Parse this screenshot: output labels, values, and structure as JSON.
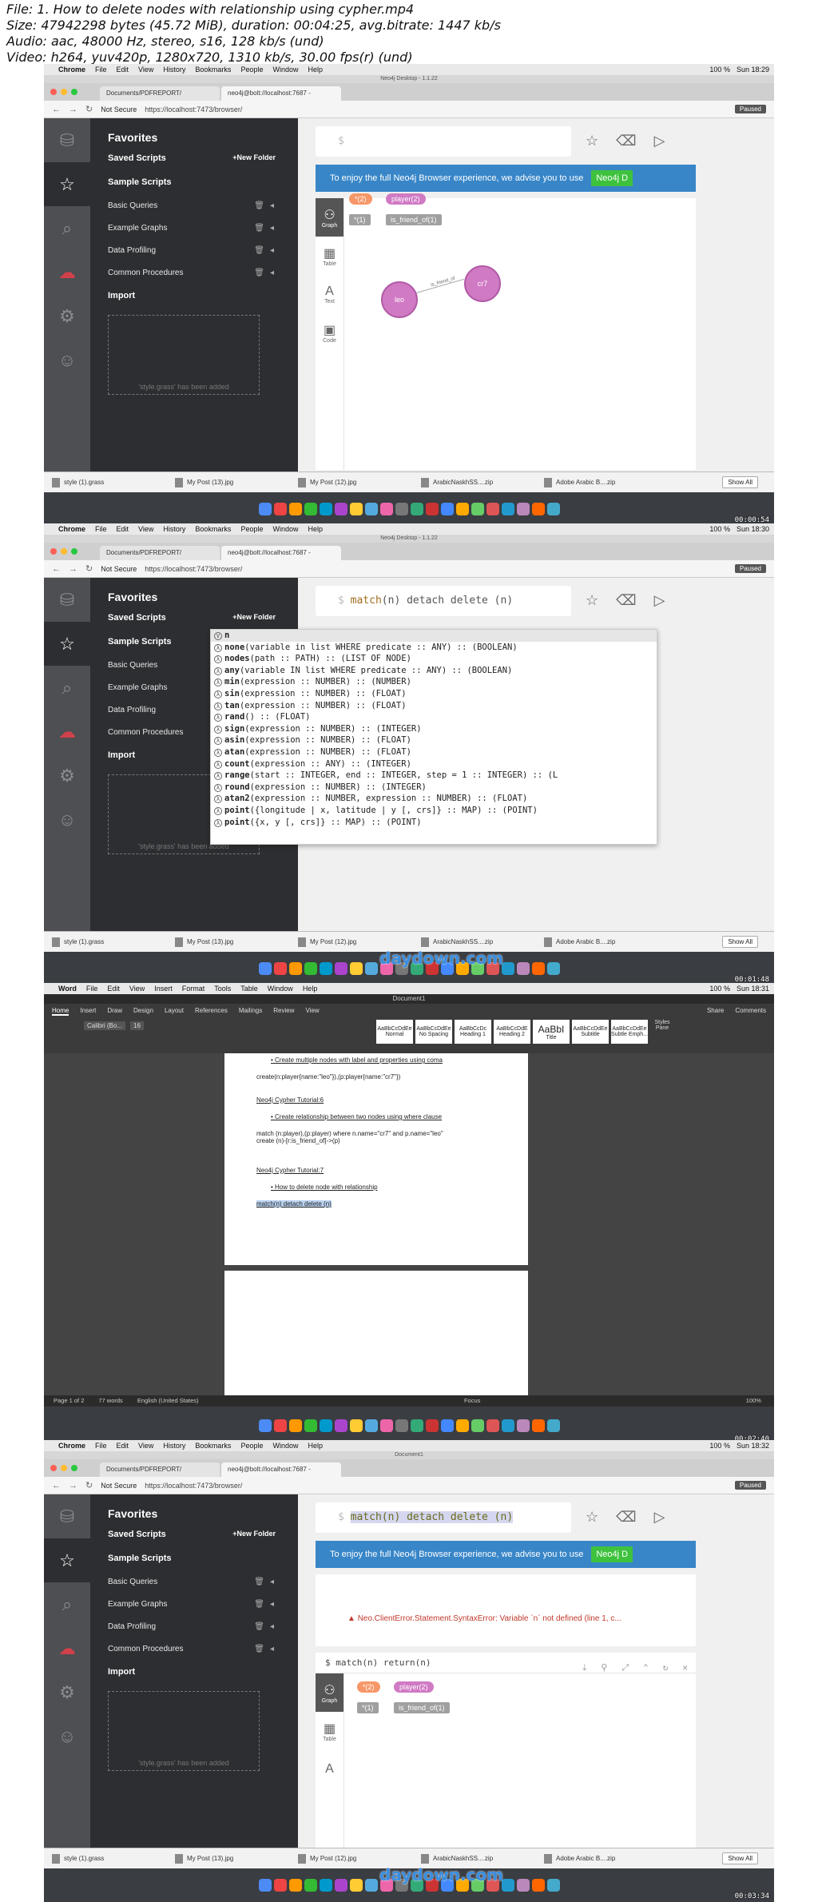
{
  "header": {
    "line1": "File: 1. How to delete nodes with relationship using cypher.mp4",
    "line2": "Size: 47942298 bytes (45.72 MiB), duration: 00:04:25, avg.bitrate: 1447 kb/s",
    "line3": "Audio: aac, 48000 Hz, stereo, s16, 128 kb/s (und)",
    "line4": "Video: h264, yuv420p, 1280x720, 1310 kb/s, 30.00 fps(r) (und)"
  },
  "menubar": {
    "chrome": [
      "Chrome",
      "File",
      "Edit",
      "View",
      "History",
      "Bookmarks",
      "People",
      "Window",
      "Help"
    ],
    "word": [
      "Word",
      "File",
      "Edit",
      "View",
      "Insert",
      "Format",
      "Tools",
      "Table",
      "Window",
      "Help"
    ],
    "battery": "100 %",
    "clock1": "Sun 18:29",
    "clock2": "Sun 18:30",
    "clock3": "Sun 18:31",
    "clock4": "Sun 18:32"
  },
  "browser": {
    "window_title": "Neo4j Desktop - 1.1.22",
    "tab1": "Documents/PDFREPORT/",
    "tab2": "neo4j@bolt://localhost:7687 -",
    "not_secure": "Not Secure",
    "url": "https://localhost:7473/browser/",
    "paused": "Paused"
  },
  "neo": {
    "favorites": "Favorites",
    "saved_scripts": "Saved Scripts",
    "new_folder": "+New Folder",
    "sample_scripts": "Sample Scripts",
    "items": [
      "Basic Queries",
      "Example Graphs",
      "Data Profiling",
      "Common Procedures"
    ],
    "import": "Import",
    "dropzone_text": "'style.grass' has been added",
    "prompt": "$",
    "banner_text": "To enjoy the full Neo4j Browser experience, we advise you to use",
    "banner_button": "Neo4j D",
    "views": [
      "Graph",
      "Table",
      "Text",
      "Code"
    ],
    "pill_all": "*(2)",
    "pill_label": "player(2)",
    "chip_all": "*(1)",
    "chip_rel": "is_friend_of(1)",
    "node_a": "leo",
    "node_b": "cr7",
    "rel_label": "is_friend_of"
  },
  "frame2": {
    "query_kw": "match",
    "query_rest": "(n) detach delete (n)",
    "autocomplete": [
      {
        "badge": "V",
        "name": "n",
        "sig": ""
      },
      {
        "badge": "λ",
        "name": "none",
        "sig": "(variable in list WHERE predicate :: ANY) :: (BOOLEAN)"
      },
      {
        "badge": "λ",
        "name": "nodes",
        "sig": "(path :: PATH) :: (LIST OF NODE)"
      },
      {
        "badge": "λ",
        "name": "any",
        "sig": "(variable IN list WHERE predicate :: ANY) :: (BOOLEAN)"
      },
      {
        "badge": "λ",
        "name": "min",
        "sig": "(expression :: NUMBER) :: (NUMBER)"
      },
      {
        "badge": "λ",
        "name": "sin",
        "sig": "(expression :: NUMBER) :: (FLOAT)"
      },
      {
        "badge": "λ",
        "name": "tan",
        "sig": "(expression :: NUMBER) :: (FLOAT)"
      },
      {
        "badge": "λ",
        "name": "rand",
        "sig": "() :: (FLOAT)"
      },
      {
        "badge": "λ",
        "name": "sign",
        "sig": "(expression :: NUMBER) :: (INTEGER)"
      },
      {
        "badge": "λ",
        "name": "asin",
        "sig": "(expression :: NUMBER) :: (FLOAT)"
      },
      {
        "badge": "λ",
        "name": "atan",
        "sig": "(expression :: NUMBER) :: (FLOAT)"
      },
      {
        "badge": "λ",
        "name": "count",
        "sig": "(expression :: ANY) :: (INTEGER)"
      },
      {
        "badge": "λ",
        "name": "range",
        "sig": "(start :: INTEGER, end :: INTEGER, step = 1 :: INTEGER) :: (L"
      },
      {
        "badge": "λ",
        "name": "round",
        "sig": "(expression :: NUMBER) :: (INTEGER)"
      },
      {
        "badge": "λ",
        "name": "atan2",
        "sig": "(expression :: NUMBER, expression :: NUMBER) :: (FLOAT)"
      },
      {
        "badge": "λ",
        "name": "point",
        "sig": "({longitude | x, latitude | y [, crs]} :: MAP) :: (POINT)"
      },
      {
        "badge": "λ",
        "name": "point",
        "sig": "({x, y [, crs]} :: MAP) :: (POINT)"
      }
    ]
  },
  "frame4": {
    "query": "match(n) detach delete (n)",
    "error": "Neo.ClientError.Statement.SyntaxError: Variable `n` not defined (line 1, c...",
    "query2": "$ match(n) return(n)"
  },
  "word": {
    "title": "Document1",
    "tabs": [
      "Home",
      "Insert",
      "Draw",
      "Design",
      "Layout",
      "References",
      "Mailings",
      "Review",
      "View"
    ],
    "share": "Share",
    "comments": "Comments",
    "font": "Calibri (Bo...",
    "font_size": "16",
    "styles": [
      {
        "sample": "AaBbCcDdEe",
        "name": "Normal"
      },
      {
        "sample": "AaBbCcDdEe",
        "name": "No Spacing"
      },
      {
        "sample": "AaBbCcDc",
        "name": "Heading 1"
      },
      {
        "sample": "AaBbCcDdE",
        "name": "Heading 2"
      },
      {
        "sample": "AaBbI",
        "name": "Title"
      },
      {
        "sample": "AaBbCcDdEe",
        "name": "Subtitle"
      },
      {
        "sample": "AaBbCcDdEe",
        "name": "Subtle Emph..."
      }
    ],
    "styles_pane": "Styles Pane",
    "doc": {
      "b1": "Create multiple nodes with label and properties using coma",
      "c1": "create(n:player{name:\"leo\"}),(p:player{name:\"cr7\"})",
      "h6": "Neo4j Cypher Tutorial:6",
      "b2": "Create relationship between two nodes using where clause",
      "c2": "match (n:player),(p:player) where n.name=\"cr7\" and p.name=\"leo\"",
      "c3": "create (n)-[r:is_friend_of]->(p)",
      "h7": "Neo4j Cypher Tutorial:7",
      "b3": "How to delete node with relationship",
      "c4": "match(n) detach delete (n)"
    },
    "status_page": "Page 1 of 2",
    "status_words": "77 words",
    "status_lang": "English (United States)",
    "status_focus": "Focus",
    "status_zoom": "100%"
  },
  "downloads": {
    "items": [
      "style (1).grass",
      "My Post (13).jpg",
      "My Post (12).jpg",
      "ArabicNaskhSS....zip",
      "Adobe Arabic B....zip"
    ],
    "show_all": "Show All"
  },
  "watermark": "daydown.com",
  "timestamps": [
    "00:00:54",
    "00:01:48",
    "00:02:40",
    "00:03:34"
  ]
}
